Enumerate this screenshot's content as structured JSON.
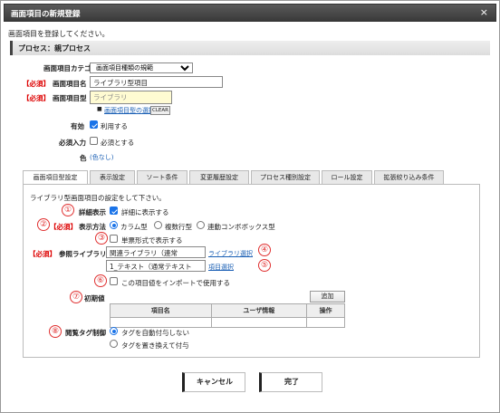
{
  "window": {
    "title": "画面項目の新規登録",
    "close_label": "×"
  },
  "intro": "画面項目を登録してください。",
  "process": "プロセス：親プロセス",
  "form": {
    "category_label": "画面項目カテゴリ",
    "category_value": "画面項目種類の規範",
    "required_tag": "【必須】",
    "name_label": "画面項目名",
    "name_value": "ライブラリ型項目",
    "type_label": "画面項目型",
    "type_value": "ライブラリ",
    "type_select_link": "画面項目型の選択",
    "clear_label": "CLEAR",
    "enabled_label": "有効",
    "enabled_checkbox": "利用する",
    "mandatory_label": "必須入力",
    "mandatory_checkbox": "必須とする",
    "color_label": "色",
    "color_value": "(色なし)"
  },
  "tabs": [
    "画面項目型設定",
    "表示設定",
    "ソート条件",
    "変更履歴設定",
    "プロセス種別設定",
    "ロール設定",
    "拡張絞り込み条件"
  ],
  "panel": {
    "description": "ライブラリ型画面項目の設定をして下さい。",
    "detail_label": "詳細表示",
    "detail_checkbox": "詳細に表示する",
    "display_method_label": "表示方法",
    "display_options": [
      "カラム型",
      "複数行型",
      "連動コンボボックス型"
    ],
    "single_form_checkbox": "単票形式で表示する",
    "ref_library_label": "参照ライブラリ",
    "ref_library_value": "関連ライブラリ（連常",
    "library_select_link": "ライブラリ選択",
    "ref_item_value": "1_テキスト（通常テキスト",
    "item_select_link": "項目選択",
    "import_checkbox": "この項目値をインポートで使用する",
    "initial_label": "初期値",
    "add_button": "追加",
    "grid_headers": [
      "項目名",
      "ユーザ情報",
      "操作"
    ],
    "tag_label": "閲覧タグ制御",
    "tag_options": [
      "タグを自動付与しない",
      "タグを置き換えて付与"
    ]
  },
  "markers": [
    "①",
    "②",
    "③",
    "④",
    "⑤",
    "⑥",
    "⑦",
    "⑧"
  ],
  "footer": {
    "cancel": "キャンセル",
    "done": "完了"
  },
  "colors": {
    "accent": "#1a73e8",
    "required": "#dd0000",
    "marker": "#e03030",
    "link": "#1a5fb4"
  }
}
